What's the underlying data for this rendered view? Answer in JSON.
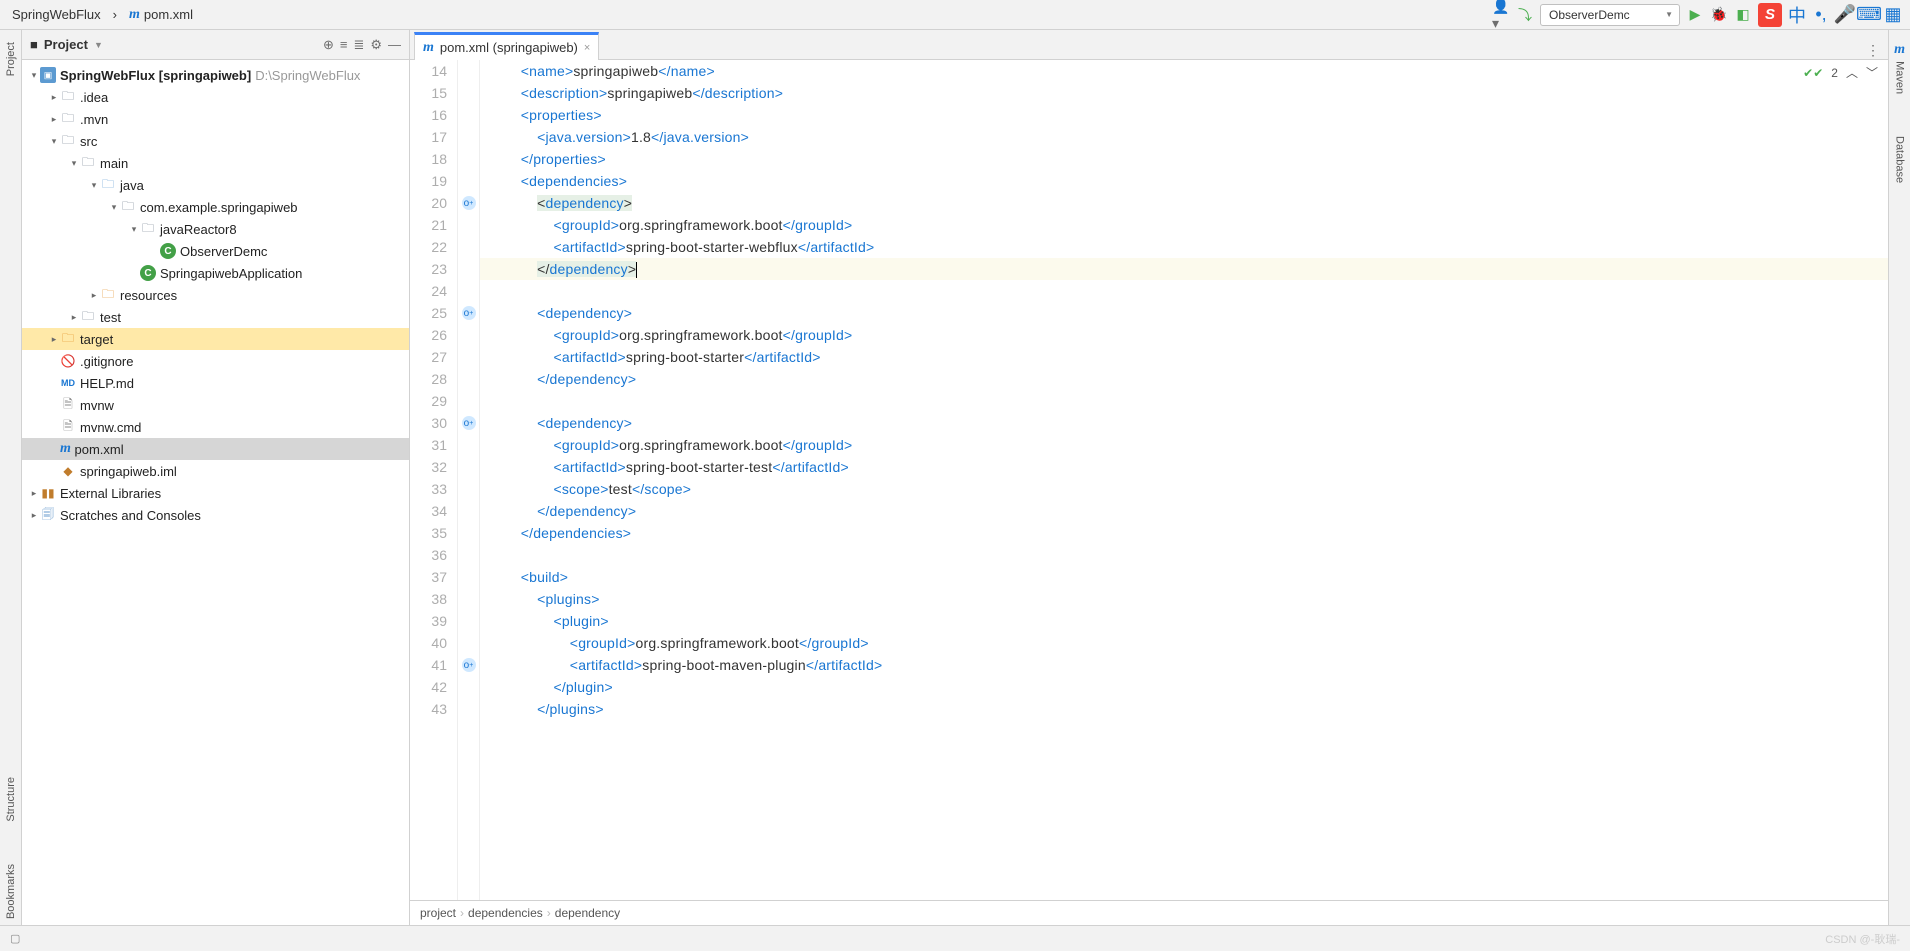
{
  "nav": {
    "crumb1": "SpringWebFlux",
    "crumb2": "pom.xml"
  },
  "toolbar": {
    "run_config": "ObserverDemc"
  },
  "project_panel": {
    "title": "Project",
    "root_name": "SpringWebFlux",
    "root_bracket": "[springapiweb]",
    "root_path": "D:\\SpringWebFlux",
    "items": {
      "idea": ".idea",
      "mvn": ".mvn",
      "src": "src",
      "main": "main",
      "java": "java",
      "pkg": "com.example.springapiweb",
      "reactor": "javaReactor8",
      "observer": "ObserverDemc",
      "app": "SpringapiwebApplication",
      "resources": "resources",
      "test": "test",
      "target": "target",
      "gitignore": ".gitignore",
      "help": "HELP.md",
      "mvnw": "mvnw",
      "mvnwcmd": "mvnw.cmd",
      "pom": "pom.xml",
      "iml": "springapiweb.iml",
      "ext": "External Libraries",
      "scratch": "Scratches and Consoles"
    }
  },
  "editor": {
    "tab_label": "pom.xml (springapiweb)",
    "inspection_count": "2",
    "lines": [
      {
        "n": 14,
        "indent": 2,
        "open": "name",
        "text": "springapiweb",
        "close": "name"
      },
      {
        "n": 15,
        "indent": 2,
        "open": "description",
        "text": "springapiweb",
        "close": "description"
      },
      {
        "n": 16,
        "indent": 2,
        "open": "properties"
      },
      {
        "n": 17,
        "indent": 3,
        "open": "java.version",
        "text": "1.8",
        "close": "java.version"
      },
      {
        "n": 18,
        "indent": 2,
        "closeOnly": "properties"
      },
      {
        "n": 19,
        "indent": 2,
        "open": "dependencies"
      },
      {
        "n": 20,
        "indent": 3,
        "open": "dependency",
        "hlOpen": true,
        "marker": "o"
      },
      {
        "n": 21,
        "indent": 4,
        "open": "groupId",
        "text": "org.springframework.boot",
        "close": "groupId"
      },
      {
        "n": 22,
        "indent": 4,
        "open": "artifactId",
        "text": "spring-boot-starter-webflux",
        "close": "artifactId"
      },
      {
        "n": 23,
        "indent": 3,
        "closeOnly": "dependency",
        "hlClose": true,
        "rowHl": true,
        "caret": true
      },
      {
        "n": 24,
        "indent": 0,
        "blank": true
      },
      {
        "n": 25,
        "indent": 3,
        "open": "dependency",
        "marker": "o"
      },
      {
        "n": 26,
        "indent": 4,
        "open": "groupId",
        "text": "org.springframework.boot",
        "close": "groupId"
      },
      {
        "n": 27,
        "indent": 4,
        "open": "artifactId",
        "text": "spring-boot-starter",
        "close": "artifactId"
      },
      {
        "n": 28,
        "indent": 3,
        "closeOnly": "dependency"
      },
      {
        "n": 29,
        "indent": 0,
        "blank": true
      },
      {
        "n": 30,
        "indent": 3,
        "open": "dependency",
        "marker": "o"
      },
      {
        "n": 31,
        "indent": 4,
        "open": "groupId",
        "text": "org.springframework.boot",
        "close": "groupId"
      },
      {
        "n": 32,
        "indent": 4,
        "open": "artifactId",
        "text": "spring-boot-starter-test",
        "close": "artifactId"
      },
      {
        "n": 33,
        "indent": 4,
        "open": "scope",
        "text": "test",
        "close": "scope"
      },
      {
        "n": 34,
        "indent": 3,
        "closeOnly": "dependency"
      },
      {
        "n": 35,
        "indent": 2,
        "closeOnly": "dependencies"
      },
      {
        "n": 36,
        "indent": 0,
        "blank": true
      },
      {
        "n": 37,
        "indent": 2,
        "open": "build"
      },
      {
        "n": 38,
        "indent": 3,
        "open": "plugins"
      },
      {
        "n": 39,
        "indent": 4,
        "open": "plugin"
      },
      {
        "n": 40,
        "indent": 5,
        "open": "groupId",
        "text": "org.springframework.boot",
        "close": "groupId"
      },
      {
        "n": 41,
        "indent": 5,
        "open": "artifactId",
        "text": "spring-boot-maven-plugin",
        "close": "artifactId",
        "marker": "o"
      },
      {
        "n": 42,
        "indent": 4,
        "closeOnly": "plugin"
      },
      {
        "n": 43,
        "indent": 3,
        "closeOnly": "plugins"
      }
    ]
  },
  "breadcrumb": {
    "a": "project",
    "b": "dependencies",
    "c": "dependency"
  },
  "rails": {
    "left_project": "Project",
    "left_structure": "Structure",
    "left_bookmarks": "Bookmarks",
    "right_maven": "Maven",
    "right_database": "Database"
  },
  "watermark": "CSDN @-耿瑞-"
}
